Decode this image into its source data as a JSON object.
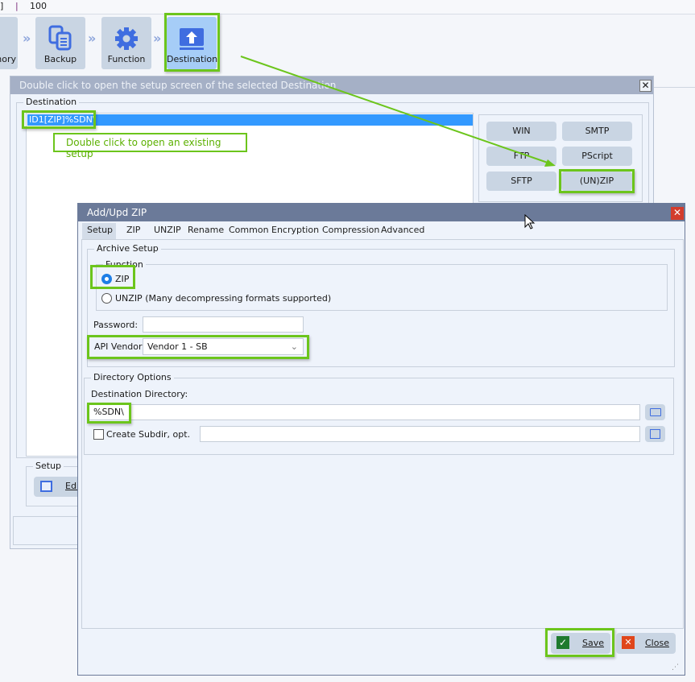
{
  "topbar": {
    "left_fragment": "]",
    "separator": "|",
    "value": "100"
  },
  "toolbar": {
    "items": [
      {
        "label": "mory",
        "icon": "memory-icon"
      },
      {
        "label": "Backup",
        "icon": "copy-documents-icon"
      },
      {
        "label": "Function",
        "icon": "gear-icon"
      },
      {
        "label": "Destination",
        "icon": "upload-icon",
        "selected": true
      }
    ]
  },
  "dest_dialog": {
    "title": "Double click to open the setup screen of the selected Destination",
    "group_label": "Destination",
    "list_items": [
      "ID1[ZIP]%SDN\\"
    ],
    "tooltip": "Double click to open an existing setup",
    "types": [
      "WIN",
      "SMTP",
      "FTP",
      "PScript",
      "SFTP",
      "(UN)ZIP"
    ],
    "setup_group": "Setup",
    "edit_label": "Edi"
  },
  "zip_dialog": {
    "title": "Add/Upd ZIP",
    "tabs": [
      "Setup",
      "ZIP",
      "UNZIP",
      "Rename",
      "Common",
      "Encryption",
      "Compression",
      "Advanced"
    ],
    "active_tab": "Setup",
    "archive_setup": {
      "label": "Archive Setup",
      "function_label": "Function",
      "options": [
        "ZIP",
        "UNZIP (Many decompressing formats supported)"
      ],
      "selected": "ZIP",
      "password_label": "Password:",
      "password_value": "",
      "api_vendor_label": "API Vendor",
      "api_vendor_value": "Vendor 1 - SB"
    },
    "directory_options": {
      "label": "Directory Options",
      "dest_dir_label": "Destination Directory:",
      "dest_dir_value": "%SDN\\",
      "create_subdir_label": "Create Subdir, opt.",
      "create_subdir_checked": false,
      "subdir_value": ""
    },
    "save_label": "Save",
    "close_label": "Close"
  },
  "colors": {
    "highlight": "#6cc51c",
    "selection": "#3399ff",
    "title_bar": "#6b7a99"
  }
}
